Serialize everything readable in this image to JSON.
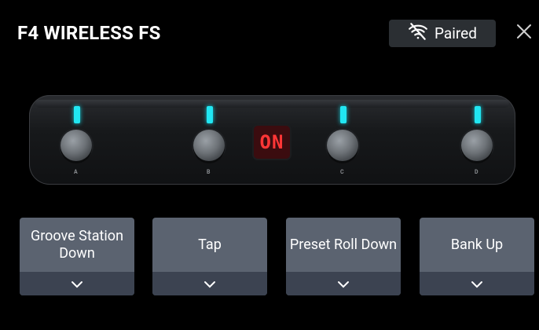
{
  "header": {
    "title": "F4 WIRELESS FS",
    "status_label": "Paired",
    "status_icon": "wifi-off-icon",
    "close_icon": "close-icon"
  },
  "pedal": {
    "display_text": "ON",
    "led_color": "#21e6f2",
    "switches": [
      {
        "label": "A"
      },
      {
        "label": "B"
      },
      {
        "label": "C"
      },
      {
        "label": "D"
      }
    ]
  },
  "assignments": [
    {
      "label": "Groove Station Down"
    },
    {
      "label": "Tap"
    },
    {
      "label": "Preset Roll Down"
    },
    {
      "label": "Bank Up"
    }
  ],
  "colors": {
    "button_top": "#5b6370",
    "button_bottom": "#3c4351",
    "display_bg": "#3b0c0f",
    "display_text": "#ff3636"
  }
}
